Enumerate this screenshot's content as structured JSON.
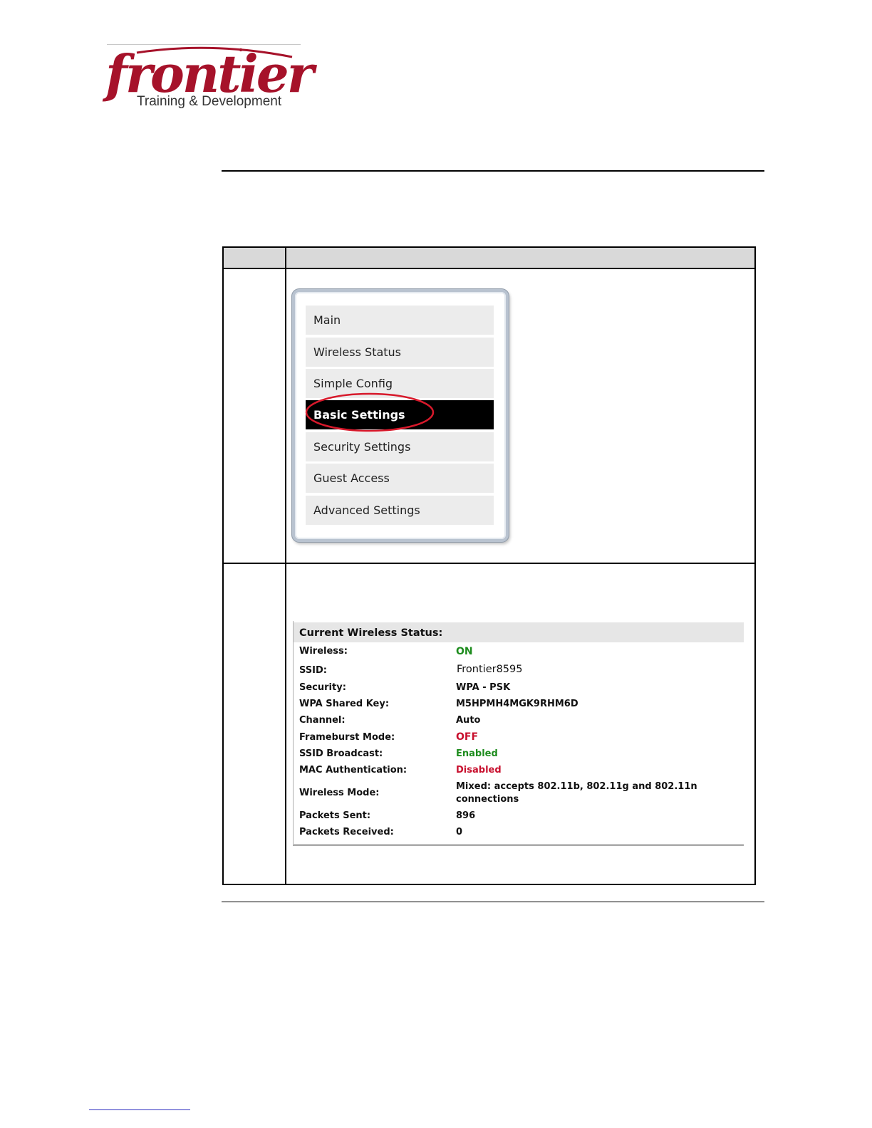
{
  "logo": {
    "wordmark": "frontier",
    "registered": "®",
    "tagline": "Training & Development"
  },
  "menu": {
    "items": [
      {
        "label": "Main",
        "active": false
      },
      {
        "label": "Wireless Status",
        "active": false
      },
      {
        "label": "Simple Config",
        "active": false
      },
      {
        "label": "Basic Settings",
        "active": true
      },
      {
        "label": "Security Settings",
        "active": false
      },
      {
        "label": "Guest Access",
        "active": false
      },
      {
        "label": "Advanced Settings",
        "active": false
      }
    ],
    "highlight_color": "#d7192b"
  },
  "status": {
    "title": "Current Wireless Status:",
    "rows": [
      {
        "label": "Wireless:",
        "value": "ON",
        "color": "green"
      },
      {
        "label": "SSID:",
        "value": "Frontier8595",
        "color": "black"
      },
      {
        "label": "Security:",
        "value": "WPA - PSK",
        "color": "black"
      },
      {
        "label": "WPA Shared Key:",
        "value": "M5HPMH4MGK9RHM6D",
        "color": "black"
      },
      {
        "label": "Channel:",
        "value": "Auto",
        "color": "black"
      },
      {
        "label": "Frameburst Mode:",
        "value": "OFF",
        "color": "red"
      },
      {
        "label": "SSID Broadcast:",
        "value": "Enabled",
        "color": "green"
      },
      {
        "label": "MAC Authentication:",
        "value": "Disabled",
        "color": "red"
      },
      {
        "label": "Wireless Mode:",
        "value": "Mixed: accepts 802.11b, 802.11g and 802.11n",
        "value2": "connections",
        "color": "black"
      },
      {
        "label": "Packets Sent:",
        "value": "896",
        "color": "black"
      },
      {
        "label": "Packets Received:",
        "value": "0",
        "color": "black"
      }
    ]
  },
  "colors": {
    "brand": "#a6122a",
    "on_green": "#1e8c1e",
    "off_red": "#c8102e",
    "table_header": "#d9d9d9"
  }
}
